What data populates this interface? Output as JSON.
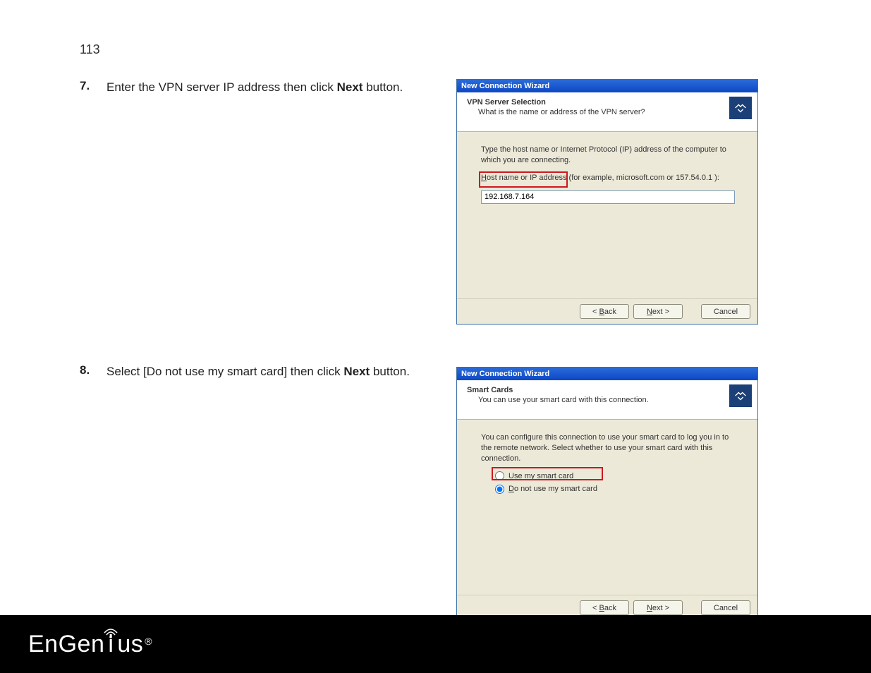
{
  "page_number": "113",
  "step7": {
    "num": "7.",
    "prefix": "Enter the VPN server IP address then click ",
    "bold": "Next",
    "suffix": " button."
  },
  "step8": {
    "num": "8.",
    "prefix": "Select [Do not use my smart card] then click ",
    "bold": "Next",
    "suffix": " button."
  },
  "wizard1": {
    "window_title": "New Connection Wizard",
    "header_title": "VPN Server Selection",
    "header_subtitle": "What is the name or address of the VPN server?",
    "body_para": "Type the host name or Internet Protocol (IP) address of the computer to which you are connecting.",
    "input_label_pre": "H",
    "input_label_rest": "ost name or IP address (for example, microsoft.com or 157.54.0.1 ):",
    "ip_value": "192.168.7.164",
    "buttons": {
      "back_pre": "< ",
      "back_ul": "B",
      "back_rest": "ack",
      "next_ul": "N",
      "next_rest": "ext >",
      "cancel": "Cancel"
    }
  },
  "wizard2": {
    "window_title": "New Connection Wizard",
    "header_title": "Smart Cards",
    "header_subtitle": "You can use your smart card with this connection.",
    "body_para": "You can configure this connection to use your smart card to log you in to the remote network.  Select whether to use your smart card with this connection.",
    "radio_use_ul": "U",
    "radio_use_rest": "se my smart card",
    "radio_dont_ul": "D",
    "radio_dont_rest": "o not use my smart card",
    "buttons": {
      "back_pre": "< ",
      "back_ul": "B",
      "back_rest": "ack",
      "next_ul": "N",
      "next_rest": "ext >",
      "cancel": "Cancel"
    }
  },
  "footer_logo": "EnGenius"
}
